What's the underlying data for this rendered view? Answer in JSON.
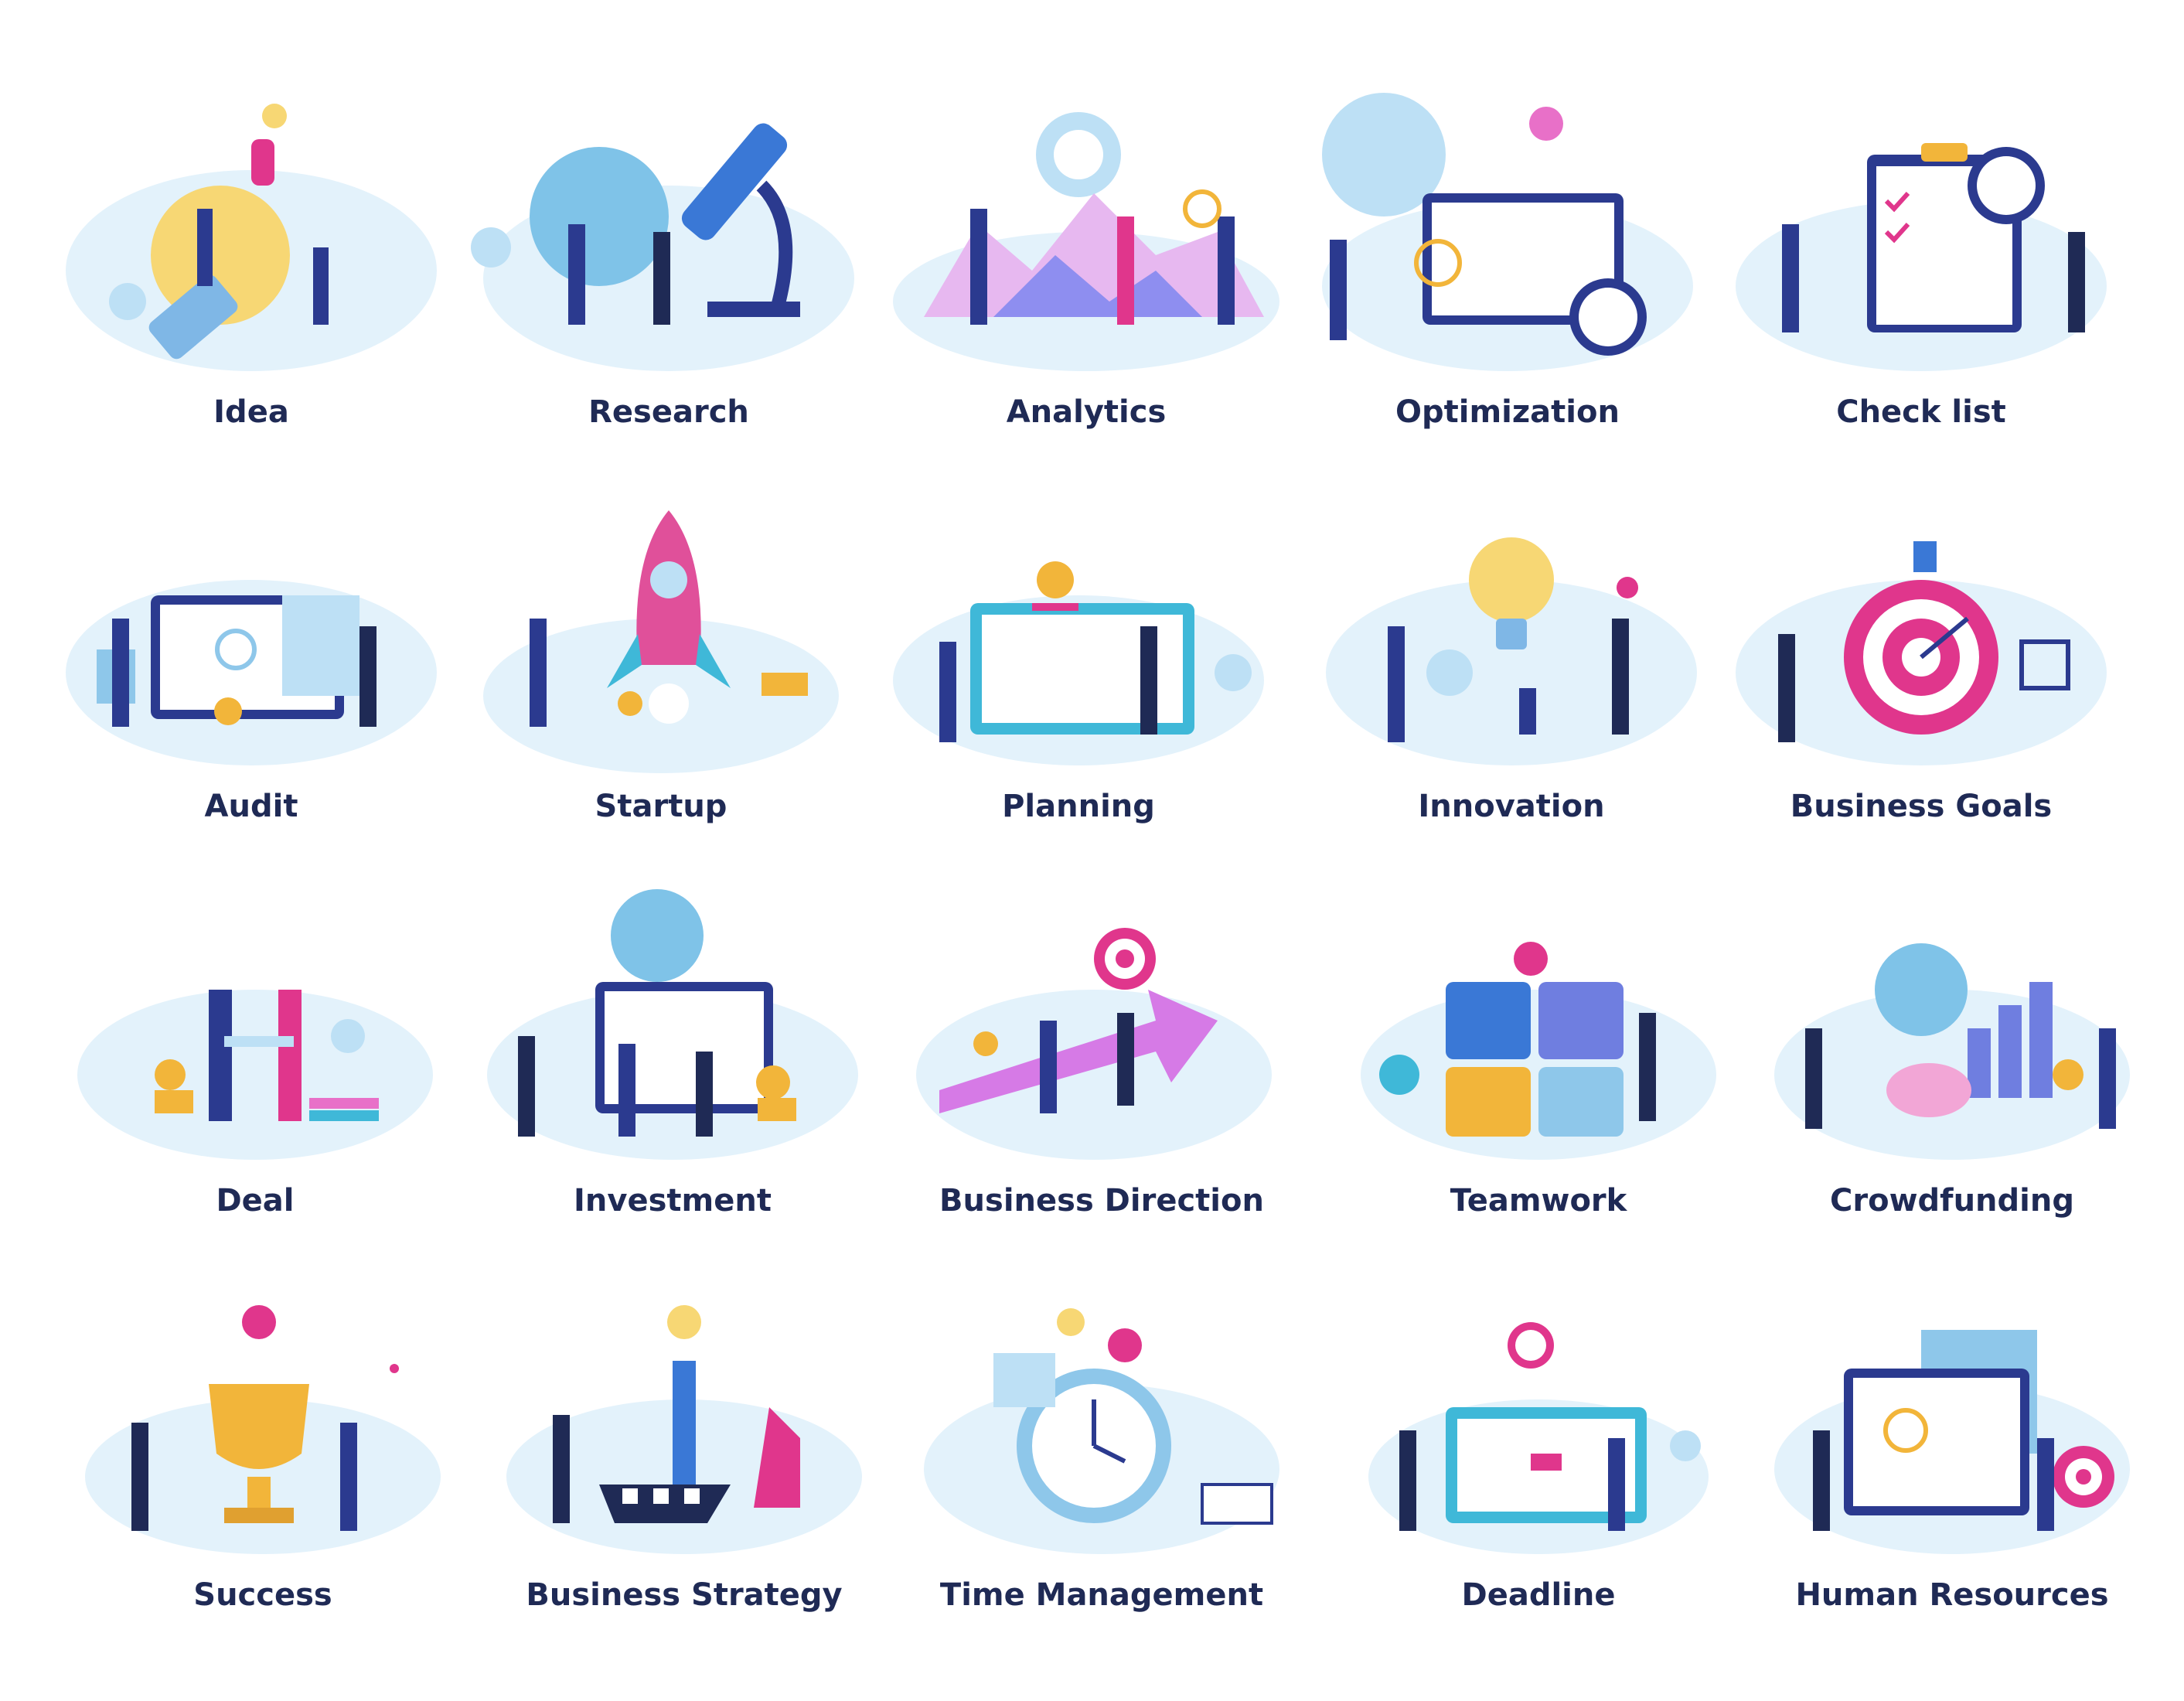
{
  "items": [
    {
      "label": "Idea",
      "icon": "lightbulb-icon",
      "accent": "#f7d774"
    },
    {
      "label": "Research",
      "icon": "microscope-icon",
      "accent": "#3a78d6"
    },
    {
      "label": "Analytics",
      "icon": "chart-icon",
      "accent": "#e870c8"
    },
    {
      "label": "Optimization",
      "icon": "stopwatch-icon",
      "accent": "#2b3a8f"
    },
    {
      "label": "Check list",
      "icon": "clipboard-icon",
      "accent": "#e0368c"
    },
    {
      "label": "Audit",
      "icon": "monitor-icon",
      "accent": "#8ec7ea"
    },
    {
      "label": "Startup",
      "icon": "rocket-icon",
      "accent": "#e0509a"
    },
    {
      "label": "Planning",
      "icon": "calendar-icon",
      "accent": "#3fb8d8"
    },
    {
      "label": "Innovation",
      "icon": "lightbulb-icon",
      "accent": "#f7d774"
    },
    {
      "label": "Business Goals",
      "icon": "target-icon",
      "accent": "#e0368c"
    },
    {
      "label": "Deal",
      "icon": "handshake-icon",
      "accent": "#f2b53a"
    },
    {
      "label": "Investment",
      "icon": "coins-icon",
      "accent": "#f2b53a"
    },
    {
      "label": "Business Direction",
      "icon": "arrow-icon",
      "accent": "#d67ae6"
    },
    {
      "label": "Teamwork",
      "icon": "puzzle-icon",
      "accent": "#3a78d6"
    },
    {
      "label": "Crowdfunding",
      "icon": "piggy-bank-icon",
      "accent": "#e870c8"
    },
    {
      "label": "Success",
      "icon": "trophy-icon",
      "accent": "#f2b53a"
    },
    {
      "label": "Business Strategy",
      "icon": "chess-icon",
      "accent": "#2b3a8f"
    },
    {
      "label": "Time Management",
      "icon": "clock-icon",
      "accent": "#8ec7ea"
    },
    {
      "label": "Deadline",
      "icon": "alarm-icon",
      "accent": "#e0368c"
    },
    {
      "label": "Human Resources",
      "icon": "resume-icon",
      "accent": "#3fb8d8"
    }
  ]
}
